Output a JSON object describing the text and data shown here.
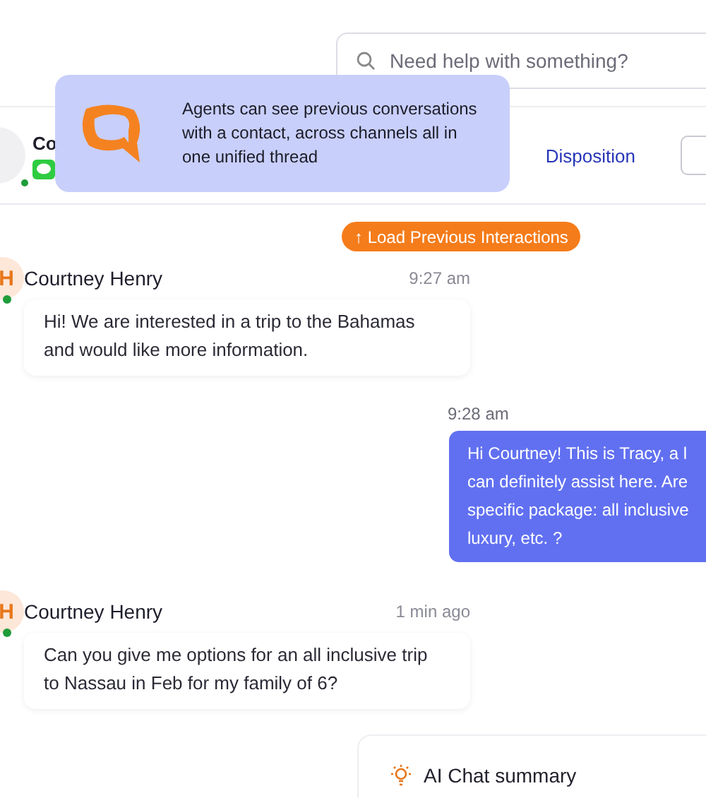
{
  "search": {
    "placeholder": "Need help with something?"
  },
  "contact": {
    "name": "Co",
    "online": true
  },
  "disposition": "Disposition",
  "tooltip": {
    "text": "Agents can see previous conversations with a contact, across channels all in one unified thread"
  },
  "load_button": "↑ Load Previous Interactions",
  "messages": [
    {
      "kind": "incoming",
      "initial": "H",
      "name": "Courtney Henry",
      "time": "9:27 am",
      "online": true,
      "lines": [
        "Hi! We are interested in a trip to the Bahamas",
        "and would like more information."
      ]
    },
    {
      "kind": "outgoing",
      "time": "9:28 am",
      "lines": [
        "Hi Courtney! This is Tracy, a l",
        "can definitely assist here. Are",
        "specific package: all inclusive",
        "luxury, etc. ?"
      ]
    },
    {
      "kind": "incoming",
      "initial": "H",
      "name": "Courtney Henry",
      "time": "1 min ago",
      "online": true,
      "lines": [
        "Can you give me options for an all inclusive trip",
        "to Nassau in Feb for my family of 6?"
      ]
    }
  ],
  "summary": {
    "title": "AI Chat summary"
  }
}
